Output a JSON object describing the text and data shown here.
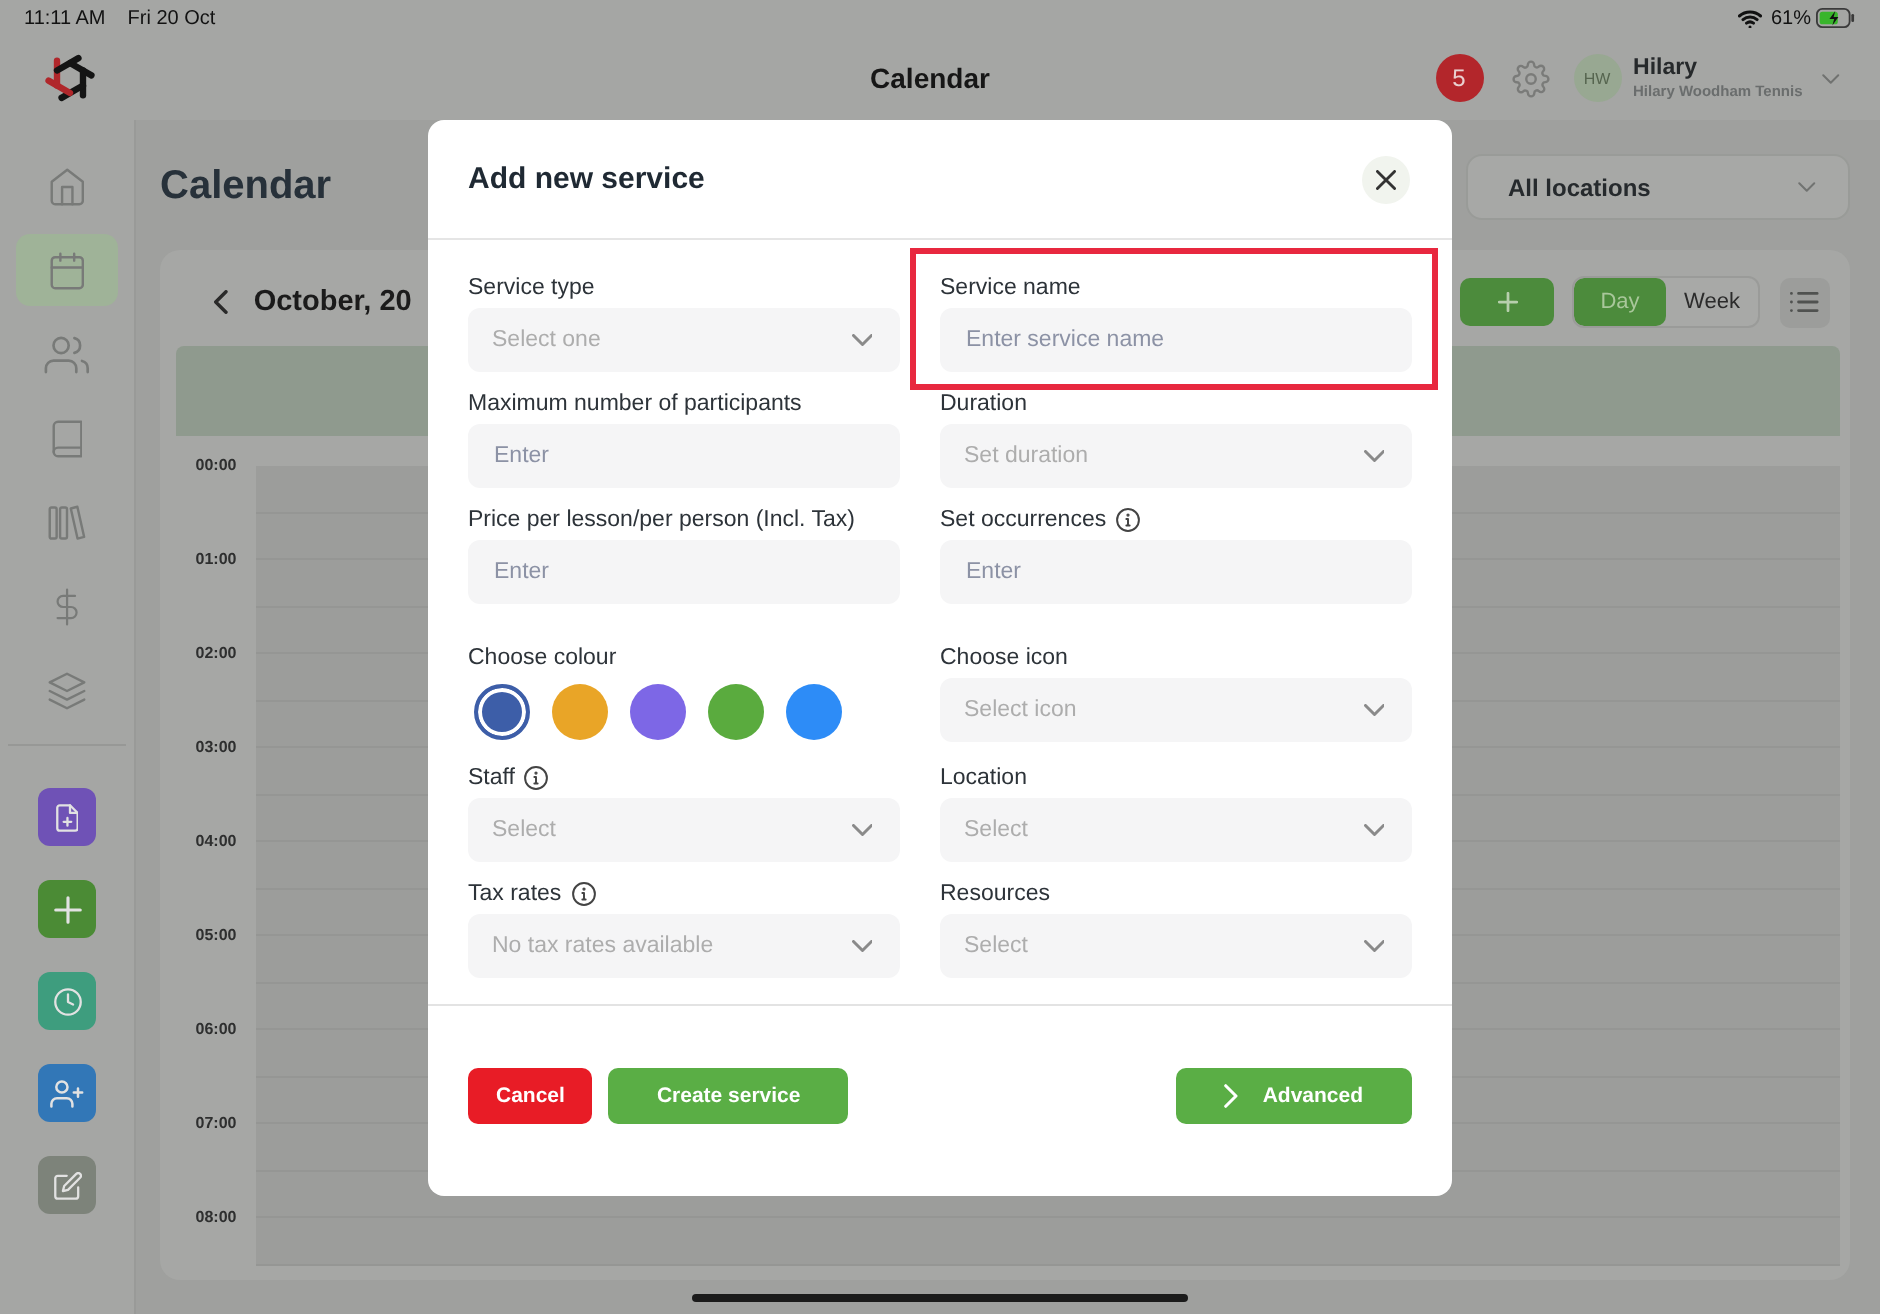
{
  "status_bar": {
    "time": "11:11 AM",
    "date": "Fri 20 Oct",
    "battery": "61%"
  },
  "top_bar": {
    "title": "Calendar",
    "notifications": "5",
    "user": {
      "initials": "HW",
      "name": "Hilary",
      "business": "Hilary Woodham Tennis"
    }
  },
  "sidebar": {
    "nav_items": [
      {
        "selected": false
      },
      {
        "selected": true
      },
      {
        "selected": false
      },
      {
        "selected": false
      },
      {
        "selected": false
      },
      {
        "selected": false
      },
      {
        "selected": false
      }
    ],
    "actions": [
      {
        "color": "#6f52b6"
      },
      {
        "color": "#4b8b35"
      },
      {
        "color": "#3e9d7e"
      },
      {
        "color": "#3277b7"
      },
      {
        "color": "#7d837a"
      }
    ]
  },
  "page": {
    "title": "Calendar",
    "location_filter": "All locations"
  },
  "calendar": {
    "month": "October, 20",
    "views": [
      {
        "label": "Day",
        "selected": true
      },
      {
        "label": "Week",
        "selected": false
      }
    ],
    "times": [
      "00:00",
      "01:00",
      "02:00",
      "03:00",
      "04:00",
      "05:00",
      "06:00",
      "07:00",
      "08:00"
    ]
  },
  "dialog": {
    "title": "Add new service",
    "fields": [
      {
        "label": "Service type",
        "kind": "select",
        "placeholder": "Select one",
        "info": false,
        "highlighted": false
      },
      {
        "label": "Service name",
        "kind": "text",
        "placeholder": "Enter service name",
        "info": false,
        "highlighted": true
      },
      {
        "label": "Maximum number of participants",
        "kind": "text",
        "placeholder": "Enter",
        "info": false,
        "highlighted": false
      },
      {
        "label": "Duration",
        "kind": "select",
        "placeholder": "Set duration",
        "info": false,
        "highlighted": false
      },
      {
        "label": "Price per lesson/per person (Incl. Tax)",
        "kind": "text",
        "placeholder": "Enter",
        "info": false,
        "highlighted": false
      },
      {
        "label": "Set occurrences",
        "kind": "text",
        "placeholder": "Enter",
        "info": true,
        "highlighted": false
      },
      {
        "label": "Choose colour",
        "kind": "colours",
        "info": false,
        "highlighted": false,
        "swatches": [
          {
            "color": "#3d5ea8",
            "selected": true
          },
          {
            "color": "#e9a527",
            "selected": false
          },
          {
            "color": "#7d67e6",
            "selected": false
          },
          {
            "color": "#5aab3e",
            "selected": false
          },
          {
            "color": "#2d8cf7",
            "selected": false
          }
        ]
      },
      {
        "label": "Choose icon",
        "kind": "select",
        "placeholder": "Select icon",
        "info": false,
        "highlighted": false
      },
      {
        "label": "Staff",
        "kind": "select",
        "placeholder": "Select",
        "info": true,
        "highlighted": false
      },
      {
        "label": "Location",
        "kind": "select",
        "placeholder": "Select",
        "info": false,
        "highlighted": false
      },
      {
        "label": "Tax rates",
        "kind": "select",
        "placeholder": "No tax rates available",
        "info": true,
        "highlighted": false
      },
      {
        "label": "Resources",
        "kind": "select",
        "placeholder": "Select",
        "info": false,
        "highlighted": false
      }
    ],
    "buttons": [
      {
        "label": "Cancel",
        "kind": "danger"
      },
      {
        "label": "Create service",
        "kind": "primary"
      },
      {
        "label": "Advanced",
        "kind": "expand"
      }
    ]
  }
}
